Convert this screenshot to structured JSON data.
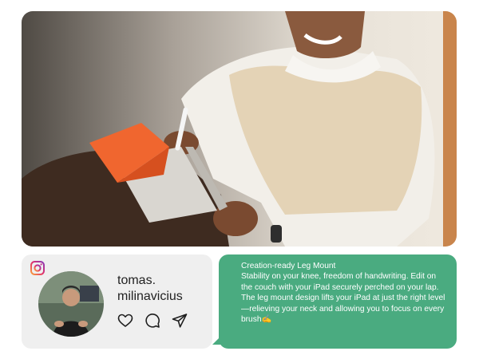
{
  "profile": {
    "username_line1": "tomas.",
    "username_line2": "milinavicius"
  },
  "post": {
    "heading": "Creation-ready Leg Mount",
    "body": "Stability on your knee, freedom of handwriting. Edit on the couch with your iPad securely perched on your lap. The leg mount design lifts your iPad at just the right level—relieving your neck and allowing you to focus on every brush✍️"
  },
  "icons": {
    "instagram": "instagram-icon",
    "like": "heart-icon",
    "comment": "comment-icon",
    "share": "send-icon"
  },
  "colors": {
    "bubble": "#4aab80",
    "card": "#efefef",
    "accent_orange": "#f0662f"
  }
}
